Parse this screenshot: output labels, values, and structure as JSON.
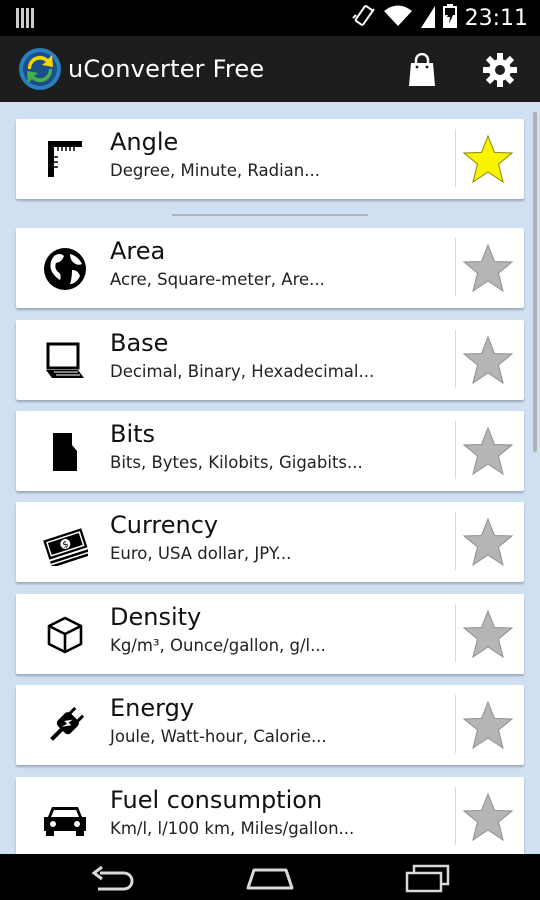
{
  "status_bar": {
    "time": "23:11"
  },
  "app": {
    "title": "uConverter Free"
  },
  "items": [
    {
      "title": "Angle",
      "subtitle": "Degree, Minute, Radian...",
      "icon": "angle-icon",
      "favorite": true
    },
    {
      "title": "Area",
      "subtitle": "Acre, Square-meter, Are...",
      "icon": "globe-icon",
      "favorite": false
    },
    {
      "title": "Base",
      "subtitle": "Decimal, Binary, Hexadecimal...",
      "icon": "laptop-icon",
      "favorite": false
    },
    {
      "title": "Bits",
      "subtitle": "Bits, Bytes, Kilobits, Gigabits...",
      "icon": "sd-card-icon",
      "favorite": false
    },
    {
      "title": "Currency",
      "subtitle": "Euro, USA dollar, JPY...",
      "icon": "money-icon",
      "favorite": false
    },
    {
      "title": "Density",
      "subtitle": "Kg/m³, Ounce/gallon, g/l...",
      "icon": "cube-icon",
      "favorite": false
    },
    {
      "title": "Energy",
      "subtitle": "Joule, Watt-hour, Calorie...",
      "icon": "plug-icon",
      "favorite": false
    },
    {
      "title": "Fuel consumption",
      "subtitle": "Km/l, l/100 km, Miles/gallon...",
      "icon": "car-icon",
      "favorite": false
    }
  ],
  "colors": {
    "background": "#cfe0f3",
    "action_bar": "#1d1d1d",
    "star_active": "#f8f400",
    "star_inactive": "#b5b5b5"
  }
}
